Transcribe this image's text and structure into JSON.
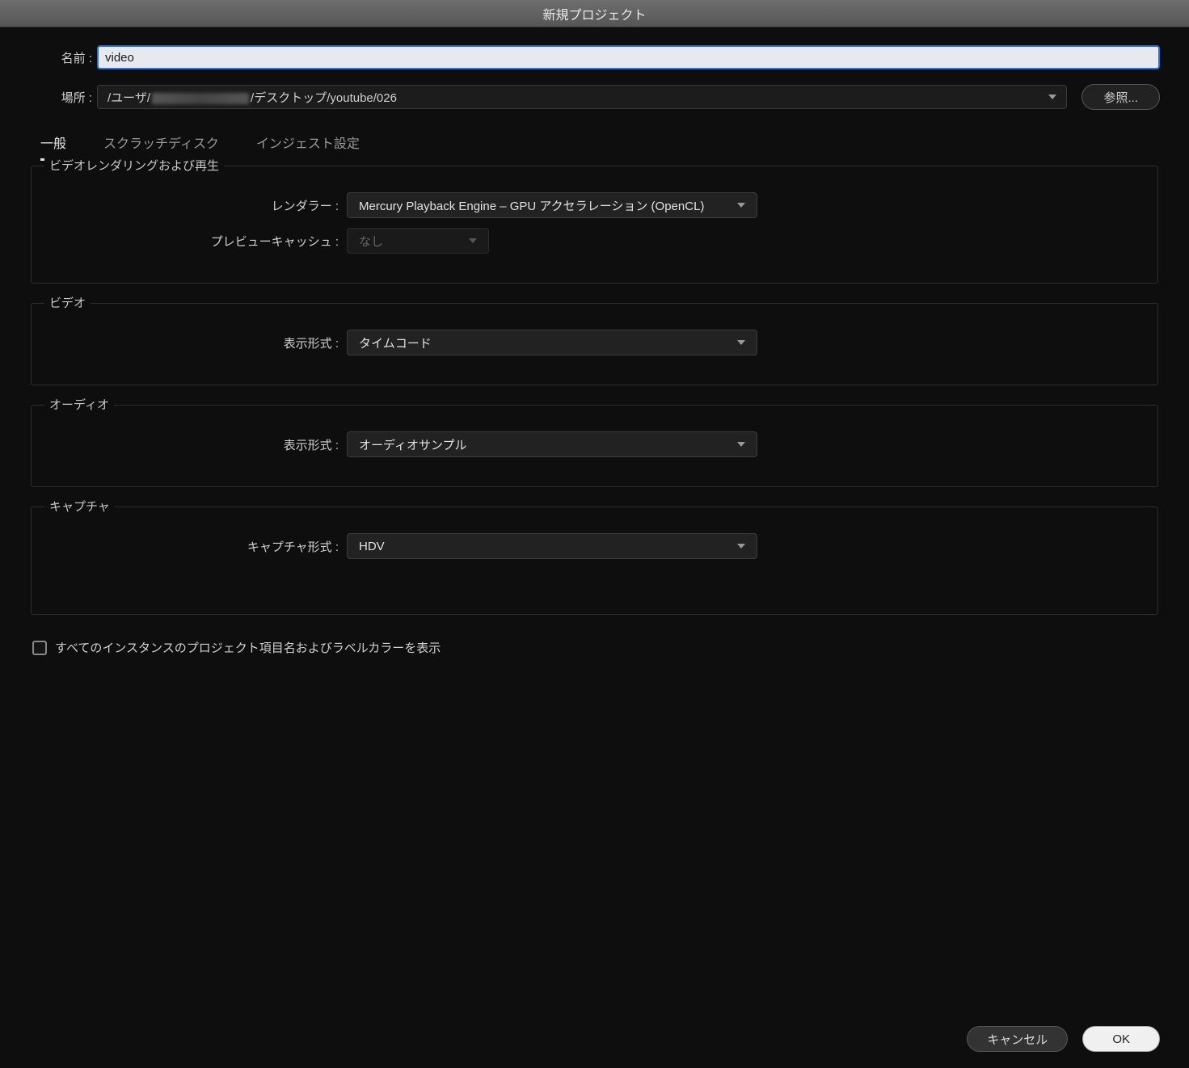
{
  "window": {
    "title": "新規プロジェクト"
  },
  "fields": {
    "name_label": "名前 :",
    "name_value": "video",
    "location_label": "場所 :",
    "location_prefix": "/ユーザ/",
    "location_suffix": "/デスクトップ/youtube/026",
    "browse": "参照..."
  },
  "tabs": {
    "general": "一般",
    "scratch": "スクラッチディスク",
    "ingest": "インジェスト設定"
  },
  "groups": {
    "render": {
      "legend": "ビデオレンダリングおよび再生",
      "renderer_label": "レンダラー :",
      "renderer_value": "Mercury Playback Engine – GPU アクセラレーション (OpenCL)",
      "preview_label": "プレビューキャッシュ :",
      "preview_value": "なし"
    },
    "video": {
      "legend": "ビデオ",
      "display_label": "表示形式 :",
      "display_value": "タイムコード"
    },
    "audio": {
      "legend": "オーディオ",
      "display_label": "表示形式 :",
      "display_value": "オーディオサンプル"
    },
    "capture": {
      "legend": "キャプチャ",
      "format_label": "キャプチャ形式 :",
      "format_value": "HDV"
    }
  },
  "checkbox": {
    "label": "すべてのインスタンスのプロジェクト項目名およびラベルカラーを表示"
  },
  "footer": {
    "cancel": "キャンセル",
    "ok": "OK"
  }
}
